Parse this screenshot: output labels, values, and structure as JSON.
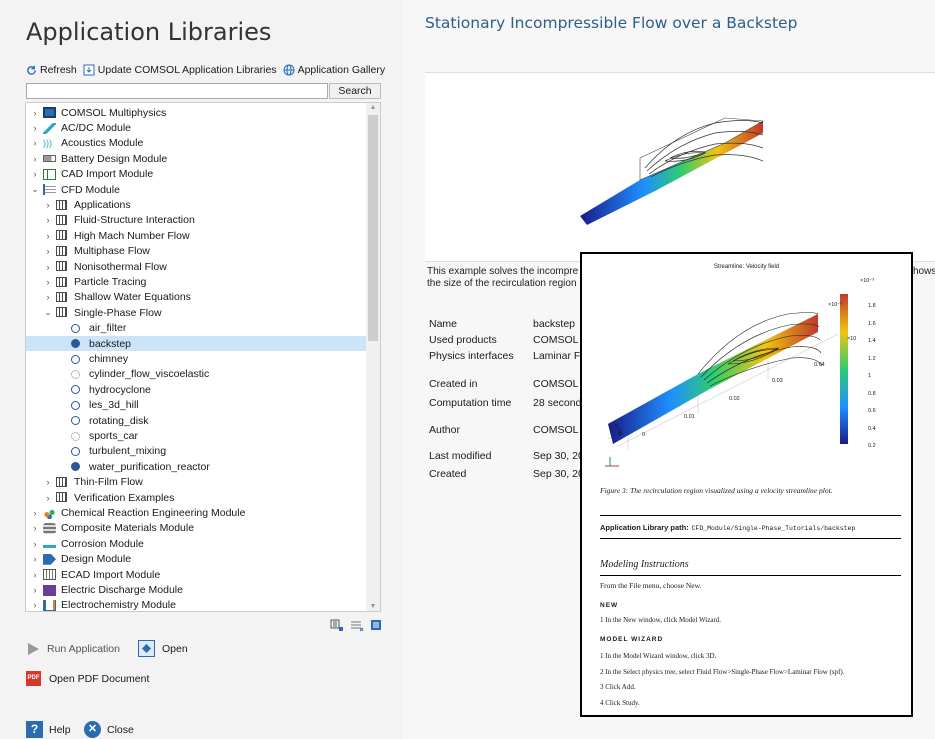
{
  "left": {
    "title": "Application Libraries",
    "toolbar": {
      "refresh": "Refresh",
      "update": "Update COMSOL Application Libraries",
      "gallery": "Application Gallery"
    },
    "search": {
      "value": "",
      "button": "Search"
    },
    "tree": [
      {
        "label": "COMSOL Multiphysics",
        "level": 0,
        "chev": ">",
        "icon": "comsol-icon"
      },
      {
        "label": "AC/DC Module",
        "level": 0,
        "chev": ">",
        "icon": "acdc-icon"
      },
      {
        "label": "Acoustics Module",
        "level": 0,
        "chev": ">",
        "icon": "acoustics-icon"
      },
      {
        "label": "Battery Design Module",
        "level": 0,
        "chev": ">",
        "icon": "battery-icon"
      },
      {
        "label": "CAD Import Module",
        "level": 0,
        "chev": ">",
        "icon": "cad-icon"
      },
      {
        "label": "CFD Module",
        "level": 0,
        "chev": "v",
        "icon": "cfd-icon"
      },
      {
        "label": "Applications",
        "level": 1,
        "chev": ">",
        "icon": "folder-icon"
      },
      {
        "label": "Fluid-Structure Interaction",
        "level": 1,
        "chev": ">",
        "icon": "folder-icon"
      },
      {
        "label": "High Mach Number Flow",
        "level": 1,
        "chev": ">",
        "icon": "folder-icon"
      },
      {
        "label": "Multiphase Flow",
        "level": 1,
        "chev": ">",
        "icon": "folder-icon"
      },
      {
        "label": "Nonisothermal Flow",
        "level": 1,
        "chev": ">",
        "icon": "folder-icon"
      },
      {
        "label": "Particle Tracing",
        "level": 1,
        "chev": ">",
        "icon": "folder-icon"
      },
      {
        "label": "Shallow Water Equations",
        "level": 1,
        "chev": ">",
        "icon": "folder-icon"
      },
      {
        "label": "Single-Phase Flow",
        "level": 1,
        "chev": "v",
        "icon": "folder-icon"
      },
      {
        "label": "air_filter",
        "level": 2,
        "icon": "model-open-icon"
      },
      {
        "label": "backstep",
        "level": 2,
        "icon": "model-filled-icon",
        "selected": true
      },
      {
        "label": "chimney",
        "level": 2,
        "icon": "model-open-icon"
      },
      {
        "label": "cylinder_flow_viscoelastic",
        "level": 2,
        "icon": "model-dotted-icon"
      },
      {
        "label": "hydrocyclone",
        "level": 2,
        "icon": "model-open-icon"
      },
      {
        "label": "les_3d_hill",
        "level": 2,
        "icon": "model-open-icon"
      },
      {
        "label": "rotating_disk",
        "level": 2,
        "icon": "model-open-icon"
      },
      {
        "label": "sports_car",
        "level": 2,
        "icon": "model-dotted-icon"
      },
      {
        "label": "turbulent_mixing",
        "level": 2,
        "icon": "model-open-icon"
      },
      {
        "label": "water_purification_reactor",
        "level": 2,
        "icon": "model-filled-icon"
      },
      {
        "label": "Thin-Film Flow",
        "level": 1,
        "chev": ">",
        "icon": "folder-icon"
      },
      {
        "label": "Verification Examples",
        "level": 1,
        "chev": ">",
        "icon": "folder-icon"
      },
      {
        "label": "Chemical Reaction Engineering Module",
        "level": 0,
        "chev": ">",
        "icon": "chemical-icon"
      },
      {
        "label": "Composite Materials Module",
        "level": 0,
        "chev": ">",
        "icon": "composite-icon"
      },
      {
        "label": "Corrosion Module",
        "level": 0,
        "chev": ">",
        "icon": "corrosion-icon"
      },
      {
        "label": "Design Module",
        "level": 0,
        "chev": ">",
        "icon": "design-icon"
      },
      {
        "label": "ECAD Import Module",
        "level": 0,
        "chev": ">",
        "icon": "ecad-icon"
      },
      {
        "label": "Electric Discharge Module",
        "level": 0,
        "chev": ">",
        "icon": "discharge-icon"
      },
      {
        "label": "Electrochemistry Module",
        "level": 0,
        "chev": ">",
        "icon": "electrochem-icon"
      }
    ],
    "actions": {
      "run": "Run Application",
      "open": "Open",
      "pdf": "Open PDF Document",
      "help": "Help",
      "close": "Close"
    }
  },
  "right": {
    "title": "Stationary Incompressible Flow over a Backstep",
    "description_line1": "This example solves the incompre",
    "description_line2": "the size of the recirculation region",
    "description_tail": "hows",
    "info": [
      {
        "key": "Name",
        "value": "backstep"
      },
      {
        "key": "Used products",
        "value": "COMSOL M"
      },
      {
        "key": "Physics interfaces",
        "value": "Laminar Fl"
      },
      {
        "key": "Created in",
        "value": "COMSOL M"
      },
      {
        "key": "Computation time",
        "value": "28 seconds"
      },
      {
        "key": "Author",
        "value": "COMSOL"
      },
      {
        "key": "Last modified",
        "value": "Sep 30, 202"
      },
      {
        "key": "Created",
        "value": "Sep 30, 202"
      }
    ]
  },
  "overlay": {
    "plot_title": "Streamline: Velocity field",
    "colorbar_exp": "×10⁻³",
    "colorbar_ticks": [
      "1.8",
      "1.6",
      "1.4",
      "1.2",
      "1",
      "0.8",
      "0.6",
      "0.4",
      "0.2"
    ],
    "axis_exp1": "×10⁻³",
    "axis_exp2": "×10",
    "axis_ticks": [
      "0.04",
      "0.03",
      "0.02",
      "0.01",
      "0"
    ],
    "zlabels": [
      "0.005",
      "0"
    ],
    "caption": "Figure 3: The recirculation region visualized using a velocity streamline plot.",
    "path_label": "Application Library path:",
    "path_value": "CFD_Module/Single-Phase_Tutorials/backstep",
    "section": "Modeling Instructions",
    "file_line": "From the File menu, choose New.",
    "new_heading": "NEW",
    "new_step": "1  In the New window, click Model Wizard.",
    "wizard_heading": "MODEL WIZARD",
    "steps": [
      "1  In the Model Wizard window, click 3D.",
      "2  In the Select physics tree, select Fluid Flow>Single-Phase Flow>Laminar Flow (spf).",
      "3  Click Add.",
      "4  Click Study."
    ]
  }
}
